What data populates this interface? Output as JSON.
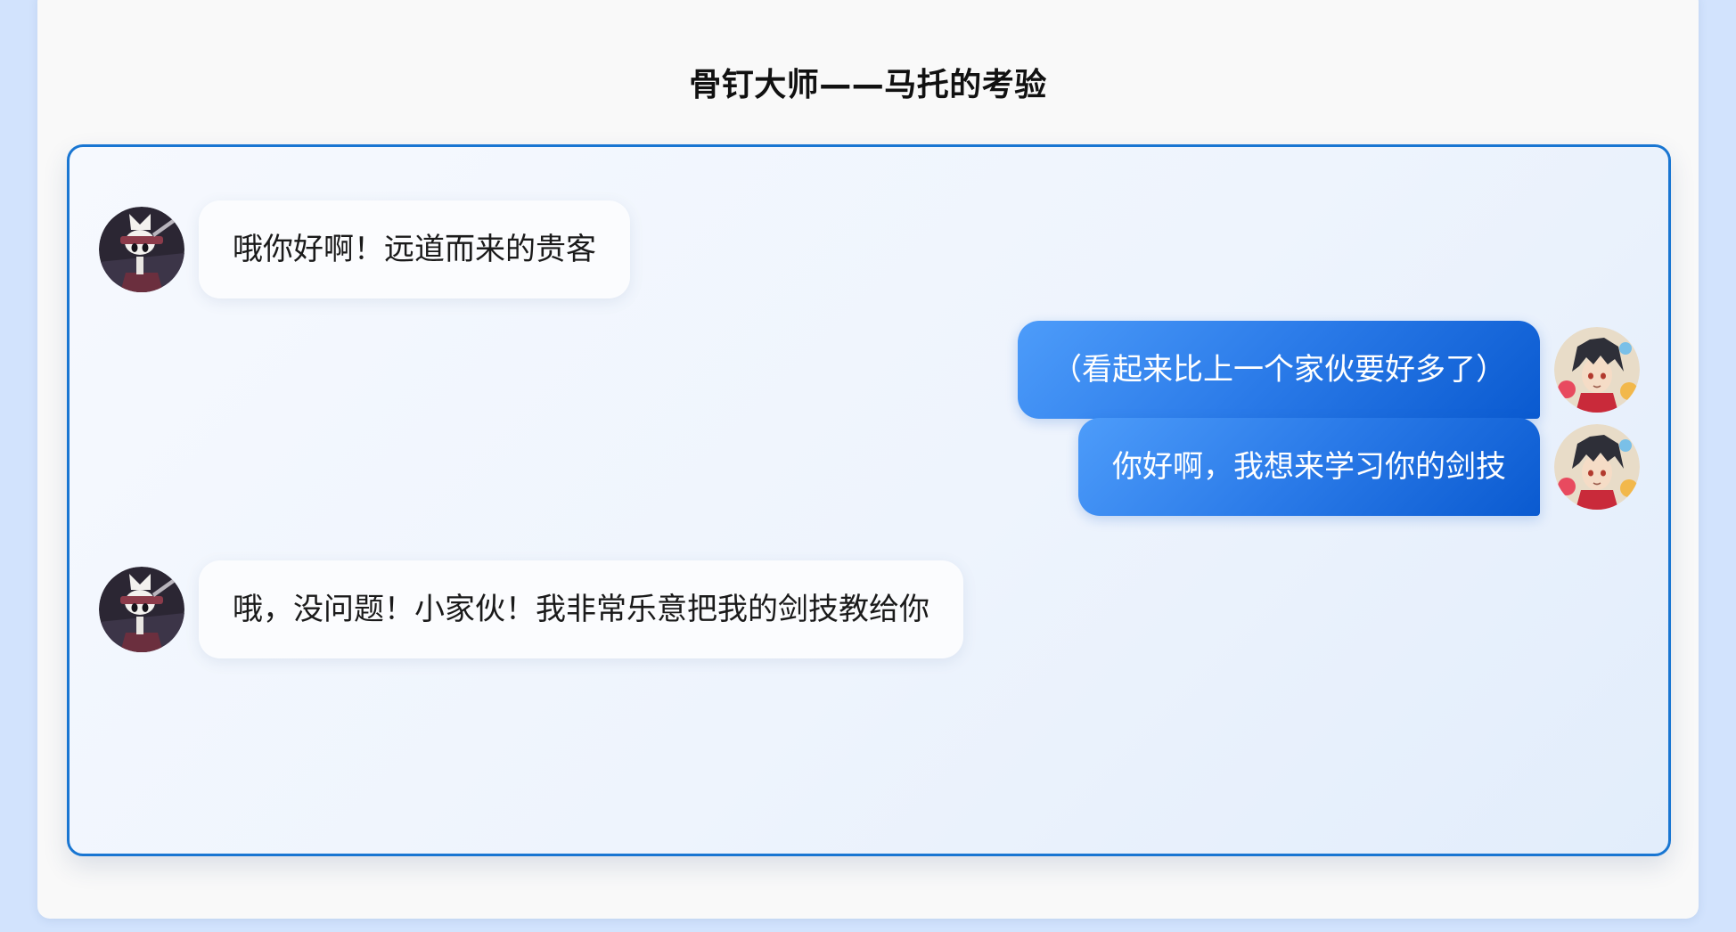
{
  "page": {
    "title": "骨钉大师——马托的考验"
  },
  "messages": [
    {
      "sender": "npc",
      "avatar_icon": "hollow-knight-masked-warrior-avatar",
      "text": "哦你好啊！远道而来的贵客"
    },
    {
      "sender": "player",
      "avatar_icon": "anime-boy-avatar",
      "text": "（看起来比上一个家伙要好多了）"
    },
    {
      "sender": "player",
      "avatar_icon": "anime-boy-avatar",
      "text": "你好啊，我想来学习你的剑技"
    },
    {
      "sender": "npc",
      "avatar_icon": "hollow-knight-masked-warrior-avatar",
      "text": "哦，没问题！小家伙！我非常乐意把我的剑技教给你"
    }
  ],
  "colors": {
    "background": "#d2e3fd",
    "accent_border": "#1976d2",
    "outgoing_bubble_start": "#4d9cfa",
    "outgoing_bubble_end": "#0a5ad0",
    "incoming_bubble": "#fbfcfe"
  }
}
